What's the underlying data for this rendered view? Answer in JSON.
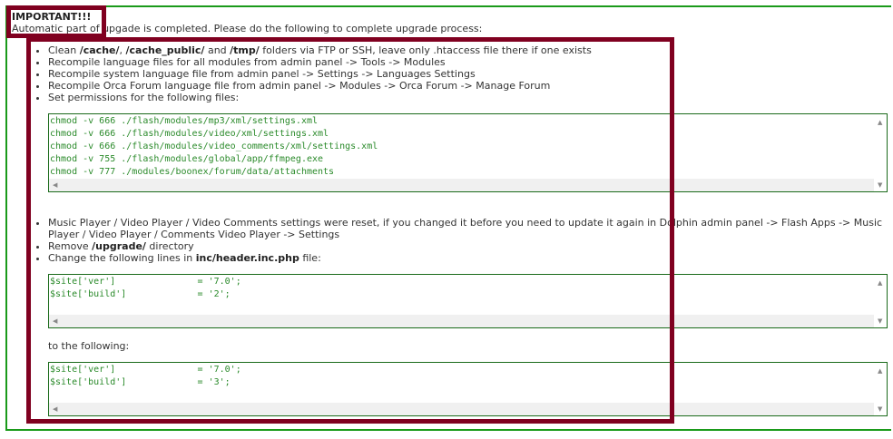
{
  "title": "IMPORTANT!!!",
  "intro": "Automatic part of upgade is completed. Please do the following to complete upgrade process:",
  "steps1": [
    {
      "pre": "Clean ",
      "b1": "/cache/",
      ", ": "",
      "mid1": ", ",
      "b2": "/cache_public/",
      "mid2": " and ",
      "b3": "/tmp/",
      "post": " folders via FTP or SSH, leave only .htaccess file there if one exists"
    },
    "Recompile language files for all modules from admin panel -> Tools -> Modules",
    "Recompile system language file from admin panel -> Settings -> Languages Settings",
    "Recompile Orca Forum language file from admin panel -> Modules -> Orca Forum -> Manage Forum",
    "Set permissions for the following files:"
  ],
  "permissions_code": "chmod -v 666 ./flash/modules/mp3/xml/settings.xml\nchmod -v 666 ./flash/modules/video/xml/settings.xml\nchmod -v 666 ./flash/modules/video_comments/xml/settings.xml\nchmod -v 755 ./flash/modules/global/app/ffmpeg.exe\nchmod -v 777 ./modules/boonex/forum/data/attachments",
  "steps2": {
    "reset": "Music Player / Video Player / Video Comments settings were reset, if you changed it before you need to update it again in Dolphin admin panel -> Flash Apps -> Music Player / Video Player / Comments Video Player -> Settings",
    "remove_pre": "Remove ",
    "remove_b": "/upgrade/",
    "remove_post": " directory",
    "change_pre": "Change the following lines in ",
    "change_b": "inc/header.inc.php",
    "change_post": " file:"
  },
  "old_code": "$site['ver']               = '7.0';\n$site['build']             = '2';",
  "to_following": "to the following:",
  "new_code": "$site['ver']               = '7.0';\n$site['build']             = '3';",
  "annotation_color": "#800020"
}
